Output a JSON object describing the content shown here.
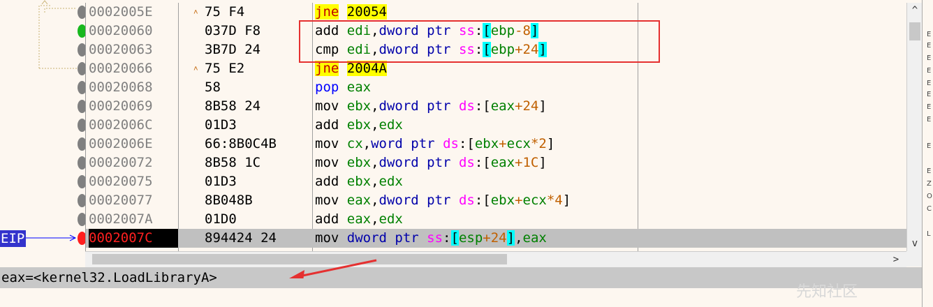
{
  "disasm": {
    "rows": [
      {
        "addr": "0002005E",
        "bytes": "75 F4",
        "jump": true,
        "dis": [
          {
            "t": "jne",
            "c": "mnem-jcc"
          },
          {
            "t": " ",
            "c": "m"
          },
          {
            "t": "20054",
            "c": "jtarget"
          }
        ]
      },
      {
        "addr": "00020060",
        "bytes": "037D F8",
        "dis": [
          {
            "t": "add ",
            "c": "m"
          },
          {
            "t": "edi",
            "c": "reg"
          },
          {
            "t": ",",
            "c": "m"
          },
          {
            "t": "dword ptr ",
            "c": "kw"
          },
          {
            "t": "ss",
            "c": "seg"
          },
          {
            "t": ":",
            "c": "m"
          },
          {
            "t": "[",
            "c": "br"
          },
          {
            "t": "ebp",
            "c": "reg"
          },
          {
            "t": "-8",
            "c": "off"
          },
          {
            "t": "]",
            "c": "br"
          }
        ]
      },
      {
        "addr": "00020063",
        "bytes": "3B7D 24",
        "dis": [
          {
            "t": "cmp ",
            "c": "m"
          },
          {
            "t": "edi",
            "c": "reg"
          },
          {
            "t": ",",
            "c": "m"
          },
          {
            "t": "dword ptr ",
            "c": "kw"
          },
          {
            "t": "ss",
            "c": "seg"
          },
          {
            "t": ":",
            "c": "m"
          },
          {
            "t": "[",
            "c": "br"
          },
          {
            "t": "ebp",
            "c": "reg"
          },
          {
            "t": "+24",
            "c": "off"
          },
          {
            "t": "]",
            "c": "br"
          }
        ]
      },
      {
        "addr": "00020066",
        "bytes": "75 E2",
        "jump": true,
        "dis": [
          {
            "t": "jne",
            "c": "mnem-jcc"
          },
          {
            "t": " ",
            "c": "m"
          },
          {
            "t": "2004A",
            "c": "jtarget"
          }
        ]
      },
      {
        "addr": "00020068",
        "bytes": "58",
        "dis": [
          {
            "t": "pop ",
            "c": "reg-blue"
          },
          {
            "t": "eax",
            "c": "reg"
          }
        ]
      },
      {
        "addr": "00020069",
        "bytes": "8B58 24",
        "dis": [
          {
            "t": "mov ",
            "c": "m"
          },
          {
            "t": "ebx",
            "c": "reg"
          },
          {
            "t": ",",
            "c": "m"
          },
          {
            "t": "dword ptr ",
            "c": "kw"
          },
          {
            "t": "ds",
            "c": "seg"
          },
          {
            "t": ":[",
            "c": "m"
          },
          {
            "t": "eax",
            "c": "reg"
          },
          {
            "t": "+24",
            "c": "off"
          },
          {
            "t": "]",
            "c": "m"
          }
        ]
      },
      {
        "addr": "0002006C",
        "bytes": "01D3",
        "dis": [
          {
            "t": "add ",
            "c": "m"
          },
          {
            "t": "ebx",
            "c": "reg"
          },
          {
            "t": ",",
            "c": "m"
          },
          {
            "t": "edx",
            "c": "reg"
          }
        ]
      },
      {
        "addr": "0002006E",
        "bytes": "66:8B0C4B",
        "dis": [
          {
            "t": "mov ",
            "c": "m"
          },
          {
            "t": "cx",
            "c": "reg"
          },
          {
            "t": ",",
            "c": "m"
          },
          {
            "t": "word ptr ",
            "c": "kw"
          },
          {
            "t": "ds",
            "c": "seg"
          },
          {
            "t": ":[",
            "c": "m"
          },
          {
            "t": "ebx",
            "c": "reg"
          },
          {
            "t": "+",
            "c": "off"
          },
          {
            "t": "ecx",
            "c": "reg"
          },
          {
            "t": "*2",
            "c": "off"
          },
          {
            "t": "]",
            "c": "m"
          }
        ]
      },
      {
        "addr": "00020072",
        "bytes": "8B58 1C",
        "dis": [
          {
            "t": "mov ",
            "c": "m"
          },
          {
            "t": "ebx",
            "c": "reg"
          },
          {
            "t": ",",
            "c": "m"
          },
          {
            "t": "dword ptr ",
            "c": "kw"
          },
          {
            "t": "ds",
            "c": "seg"
          },
          {
            "t": ":[",
            "c": "m"
          },
          {
            "t": "eax",
            "c": "reg"
          },
          {
            "t": "+1C",
            "c": "off"
          },
          {
            "t": "]",
            "c": "m"
          }
        ]
      },
      {
        "addr": "00020075",
        "bytes": "01D3",
        "dis": [
          {
            "t": "add ",
            "c": "m"
          },
          {
            "t": "ebx",
            "c": "reg"
          },
          {
            "t": ",",
            "c": "m"
          },
          {
            "t": "edx",
            "c": "reg"
          }
        ]
      },
      {
        "addr": "00020077",
        "bytes": "8B048B",
        "dis": [
          {
            "t": "mov ",
            "c": "m"
          },
          {
            "t": "eax",
            "c": "reg"
          },
          {
            "t": ",",
            "c": "m"
          },
          {
            "t": "dword ptr ",
            "c": "kw"
          },
          {
            "t": "ds",
            "c": "seg"
          },
          {
            "t": ":[",
            "c": "m"
          },
          {
            "t": "ebx",
            "c": "reg"
          },
          {
            "t": "+",
            "c": "off"
          },
          {
            "t": "ecx",
            "c": "reg"
          },
          {
            "t": "*4",
            "c": "off"
          },
          {
            "t": "]",
            "c": "m"
          }
        ]
      },
      {
        "addr": "0002007A",
        "bytes": "01D0",
        "dis": [
          {
            "t": "add ",
            "c": "m"
          },
          {
            "t": "eax",
            "c": "reg"
          },
          {
            "t": ",",
            "c": "m"
          },
          {
            "t": "edx",
            "c": "reg"
          }
        ]
      },
      {
        "addr": "0002007C",
        "bytes": "894424 24",
        "eip": true,
        "dis": [
          {
            "t": "mov ",
            "c": "m"
          },
          {
            "t": "dword ptr ",
            "c": "kw"
          },
          {
            "t": "ss",
            "c": "seg"
          },
          {
            "t": ":",
            "c": "m"
          },
          {
            "t": "[",
            "c": "br"
          },
          {
            "t": "esp",
            "c": "reg"
          },
          {
            "t": "+24",
            "c": "off"
          },
          {
            "t": "]",
            "c": "br"
          },
          {
            "t": ",",
            "c": "m"
          },
          {
            "t": "eax",
            "c": "reg"
          }
        ]
      }
    ]
  },
  "eip_label": "EIP",
  "status_text": "eax=<kernel32.LoadLibraryA>",
  "scroll": {
    "up": "^",
    "down": "v",
    "left": "<",
    "right": ">"
  },
  "right_panel_letters": [
    "E",
    "E",
    "E",
    "E",
    "E",
    "E",
    "E",
    "E",
    "E",
    "E",
    "Z",
    "O",
    "C",
    "L"
  ],
  "watermark": "先知社区"
}
